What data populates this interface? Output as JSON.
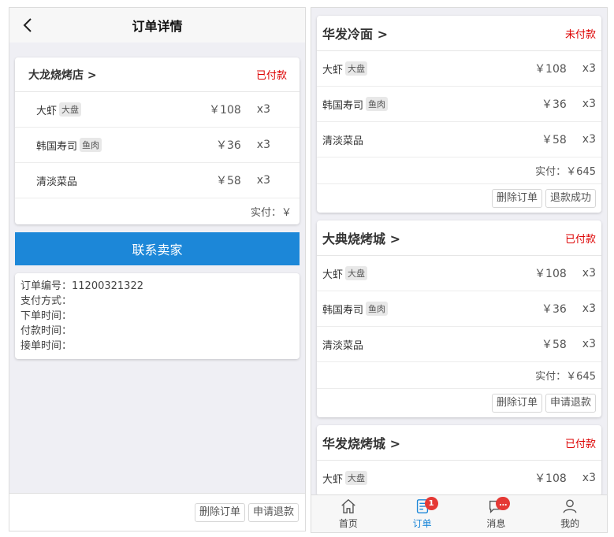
{
  "detail": {
    "title": "订单详情",
    "shop": "大龙烧烤店 >",
    "status": "已付款",
    "items": [
      {
        "name": "大虾",
        "tag": "大盘",
        "price": "￥108",
        "qty": "x3"
      },
      {
        "name": "韩国寿司",
        "tag": "鱼肉",
        "price": "￥36",
        "qty": "x3"
      },
      {
        "name": "清淡菜品",
        "tag": "",
        "price": "￥58",
        "qty": "x3"
      }
    ],
    "paid": "实付：￥",
    "contact_label": "联系卖家",
    "info": {
      "order_no": "订单编号：11200321322",
      "pay_method": "支付方式：",
      "order_time": "下单时间：",
      "pay_time": "付款时间：",
      "accept_time": "接单时间："
    },
    "delete_label": "删除订单",
    "refund_label": "申请退款"
  },
  "orders": [
    {
      "shop": "华发冷面 >",
      "status": "未付款",
      "items": [
        {
          "name": "大虾",
          "tag": "大盘",
          "price": "￥108",
          "qty": "x3"
        },
        {
          "name": "韩国寿司",
          "tag": "鱼肉",
          "price": "￥36",
          "qty": "x3"
        },
        {
          "name": "清淡菜品",
          "tag": "",
          "price": "￥58",
          "qty": "x3"
        }
      ],
      "paid": "实付：￥645",
      "btn1": "删除订单",
      "btn2": "退款成功"
    },
    {
      "shop": "大典烧烤城 >",
      "status": "已付款",
      "items": [
        {
          "name": "大虾",
          "tag": "大盘",
          "price": "￥108",
          "qty": "x3"
        },
        {
          "name": "韩国寿司",
          "tag": "鱼肉",
          "price": "￥36",
          "qty": "x3"
        },
        {
          "name": "清淡菜品",
          "tag": "",
          "price": "￥58",
          "qty": "x3"
        }
      ],
      "paid": "实付：￥645",
      "btn1": "删除订单",
      "btn2": "申请退款"
    },
    {
      "shop": "华发烧烤城 >",
      "status": "已付款",
      "items": [
        {
          "name": "大虾",
          "tag": "大盘",
          "price": "￥108",
          "qty": "x3"
        }
      ]
    }
  ],
  "tabbar": {
    "home": "首页",
    "orders": "订单",
    "orders_badge": "1",
    "messages": "消息",
    "messages_badge": "…",
    "mine": "我的"
  },
  "colors": {
    "accent": "#1c87d8",
    "status_red": "#dd0000",
    "badge_red": "#e53935"
  }
}
